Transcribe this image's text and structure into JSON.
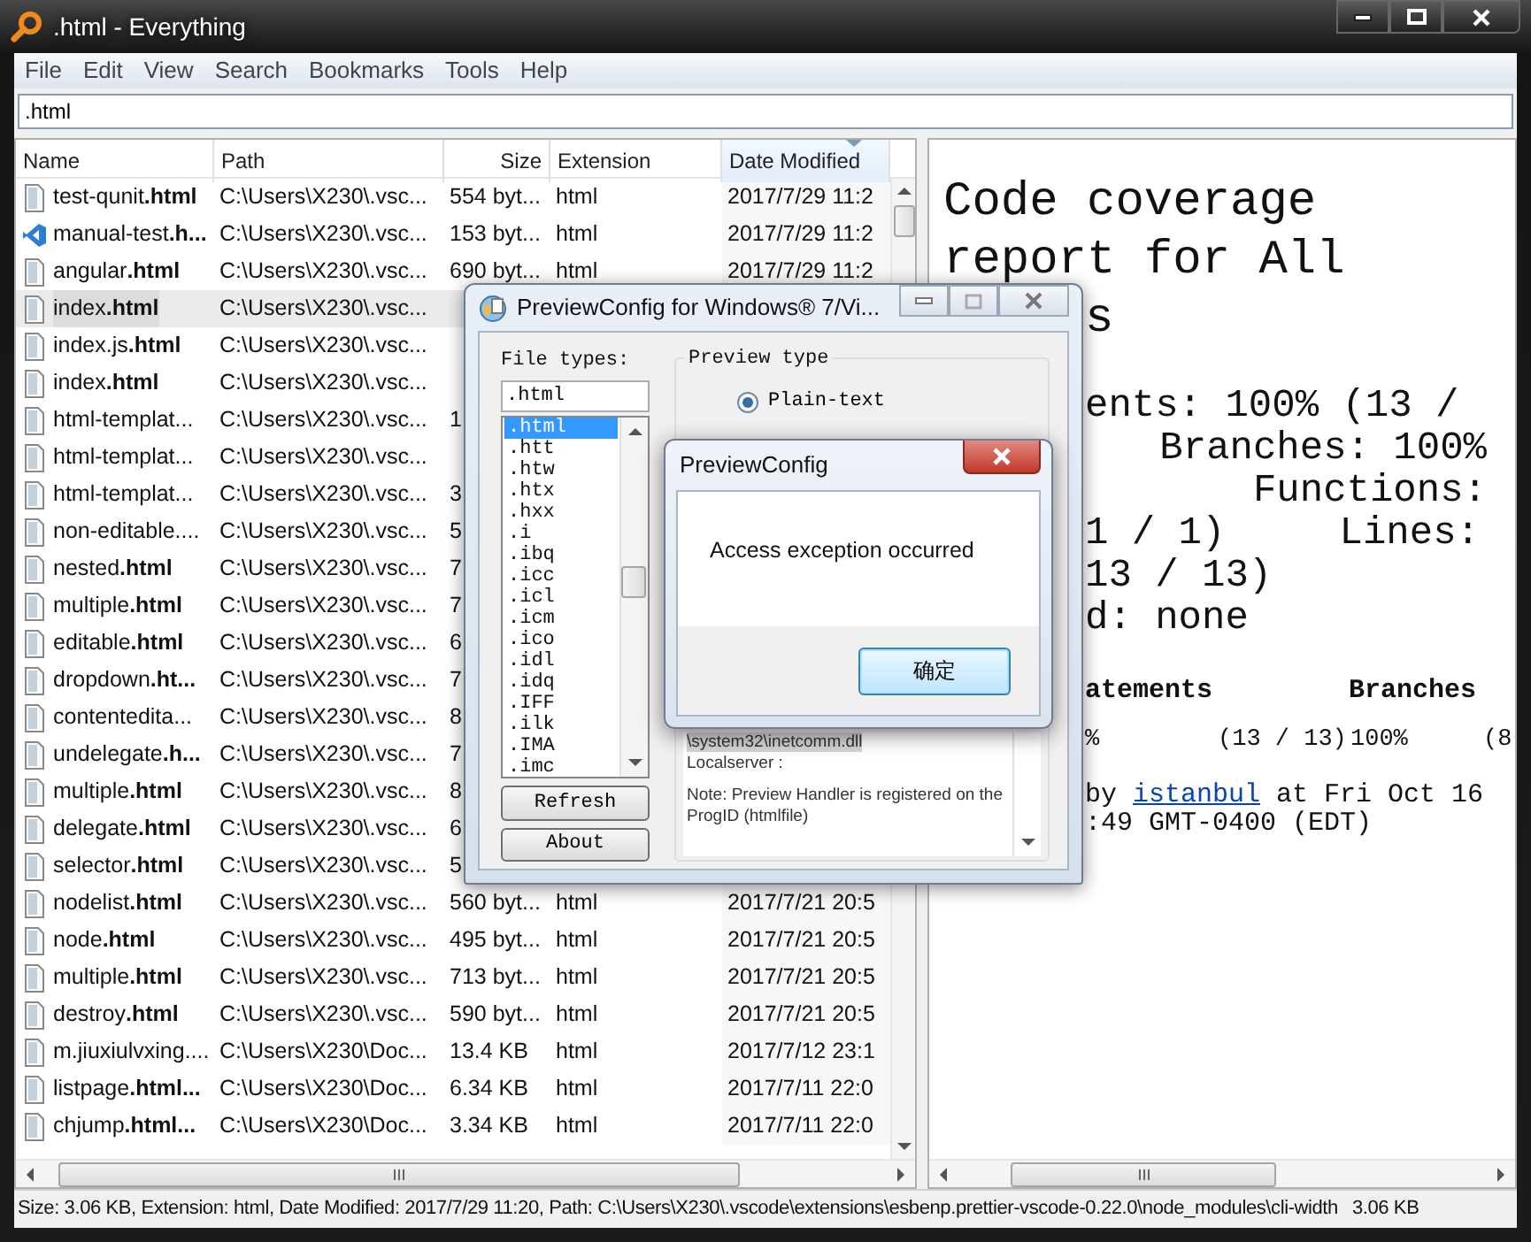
{
  "window": {
    "title": ".html - Everything"
  },
  "menu": [
    "File",
    "Edit",
    "View",
    "Search",
    "Bookmarks",
    "Tools",
    "Help"
  ],
  "search": {
    "value": ".html"
  },
  "file_list": {
    "columns": [
      {
        "label": "Name",
        "sorted": false
      },
      {
        "label": "Path",
        "sorted": false
      },
      {
        "label": "Size",
        "sorted": false
      },
      {
        "label": "Extension",
        "sorted": false
      },
      {
        "label": "Date Modified",
        "sorted": true
      }
    ],
    "rows": [
      {
        "kind": "page",
        "name": "test-qunit**.html**",
        "path": "C:\\Users\\X230\\.vsc...",
        "size": "554 byt...",
        "ext": "html",
        "date": "2017/7/29 11:2",
        "selected": false
      },
      {
        "kind": "vscode",
        "name": "manual-test**.h...**",
        "path": "C:\\Users\\X230\\.vsc...",
        "size": "153 byt...",
        "ext": "html",
        "date": "2017/7/29 11:2",
        "selected": false
      },
      {
        "kind": "page",
        "name": "angular**.html**",
        "path": "C:\\Users\\X230\\.vsc...",
        "size": "690 byt...",
        "ext": "html",
        "date": "2017/7/29 11:2",
        "selected": false
      },
      {
        "kind": "page",
        "name": "index**.html**",
        "path": "C:\\Users\\X230\\.vsc...",
        "selected": true
      },
      {
        "kind": "page",
        "name": "index.js**.html**",
        "path": "C:\\Users\\X230\\.vsc...",
        "selected": false
      },
      {
        "kind": "page",
        "name": "index**.html**",
        "path": "C:\\Users\\X230\\.vsc...",
        "selected": false
      },
      {
        "kind": "page",
        "name": "html-templat...",
        "path": "C:\\Users\\X230\\.vsc...",
        "size": "1",
        "selected": false
      },
      {
        "kind": "page",
        "name": "html-templat...",
        "path": "C:\\Users\\X230\\.vsc...",
        "selected": false
      },
      {
        "kind": "page",
        "name": "html-templat...",
        "path": "C:\\Users\\X230\\.vsc...",
        "size": "3",
        "selected": false
      },
      {
        "kind": "page",
        "name": "non-editable....",
        "path": "C:\\Users\\X230\\.vsc...",
        "size": "5",
        "selected": false
      },
      {
        "kind": "page",
        "name": "nested**.html**",
        "path": "C:\\Users\\X230\\.vsc...",
        "size": "7",
        "selected": false
      },
      {
        "kind": "page",
        "name": "multiple**.html**",
        "path": "C:\\Users\\X230\\.vsc...",
        "size": "7",
        "selected": false
      },
      {
        "kind": "page",
        "name": "editable**.html**",
        "path": "C:\\Users\\X230\\.vsc...",
        "size": "6",
        "selected": false
      },
      {
        "kind": "page",
        "name": "dropdown**.ht...**",
        "path": "C:\\Users\\X230\\.vsc...",
        "size": "7",
        "selected": false
      },
      {
        "kind": "page",
        "name": "contentedita...",
        "path": "C:\\Users\\X230\\.vsc...",
        "size": "8",
        "selected": false
      },
      {
        "kind": "page",
        "name": "undelegate**.h...**",
        "path": "C:\\Users\\X230\\.vsc...",
        "size": "7",
        "selected": false
      },
      {
        "kind": "page",
        "name": "multiple**.html**",
        "path": "C:\\Users\\X230\\.vsc...",
        "size": "8",
        "selected": false
      },
      {
        "kind": "page",
        "name": "delegate**.html**",
        "path": "C:\\Users\\X230\\.vsc...",
        "size": "6",
        "selected": false
      },
      {
        "kind": "page",
        "name": "selector**.html**",
        "path": "C:\\Users\\X230\\.vsc...",
        "size": "5",
        "selected": false
      },
      {
        "kind": "page",
        "name": "nodelist**.html**",
        "path": "C:\\Users\\X230\\.vsc...",
        "size": "560 byt...",
        "ext": "html",
        "date": "2017/7/21 20:5",
        "selected": false
      },
      {
        "kind": "page",
        "name": "node**.html**",
        "path": "C:\\Users\\X230\\.vsc...",
        "size": "495 byt...",
        "ext": "html",
        "date": "2017/7/21 20:5",
        "selected": false
      },
      {
        "kind": "page",
        "name": "multiple**.html**",
        "path": "C:\\Users\\X230\\.vsc...",
        "size": "713 byt...",
        "ext": "html",
        "date": "2017/7/21 20:5",
        "selected": false
      },
      {
        "kind": "page",
        "name": "destroy**.html**",
        "path": "C:\\Users\\X230\\.vsc...",
        "size": "590 byt...",
        "ext": "html",
        "date": "2017/7/21 20:5",
        "selected": false
      },
      {
        "kind": "page",
        "name": "m.jiuxiulvxing....",
        "path": "C:\\Users\\X230\\Doc...",
        "size": "13.4 KB",
        "ext": "html",
        "date": "2017/7/12 23:1",
        "selected": false
      },
      {
        "kind": "page",
        "name": "listpage**.html...**",
        "path": "C:\\Users\\X230\\Doc...",
        "size": "6.34 KB",
        "ext": "html",
        "date": "2017/7/11 22:0",
        "selected": false
      },
      {
        "kind": "page",
        "name": "chjump**.html...**",
        "path": "C:\\Users\\X230\\Doc...",
        "size": "3.34 KB",
        "ext": "html",
        "date": "2017/7/11 22:0",
        "selected": false
      }
    ]
  },
  "preview": {
    "lines": [
      {
        "kind": "title",
        "segments": [
          "Code coverage"
        ]
      },
      {
        "kind": "title",
        "segments": [
          "report for All"
        ]
      },
      {
        "kind": "title-cut",
        "segments": [
          "s"
        ]
      },
      {
        "kind": "summary-cut",
        "segments": [
          "ents: 100% (13 /"
        ]
      },
      {
        "kind": "summary-right",
        "segments": [
          "Branches: 100%"
        ]
      },
      {
        "kind": "summary-right",
        "segments": [
          "Functions:"
        ]
      },
      {
        "kind": "summary-spread",
        "segments": [
          "1 / 1)",
          "Lines:"
        ]
      },
      {
        "kind": "summary-cut",
        "segments": [
          "13 / 13)"
        ]
      },
      {
        "kind": "summary-cut",
        "segments": [
          "d: none"
        ]
      },
      {
        "kind": "table-head",
        "segments": [
          "atements",
          "Branches"
        ]
      },
      {
        "kind": "table-row",
        "segments": [
          "%",
          "(13 / 13)",
          "100%",
          "(8"
        ]
      }
    ],
    "footer": {
      "before": "by",
      "link": "istanbul",
      "after": "at Fri Oct 16"
    },
    "footer_time": ":49 GMT-0400 (EDT)"
  },
  "status_bar": {
    "text": "Size: 3.06 KB, Extension: html, Date Modified: 2017/7/29 11:20, Path: C:\\Users\\X230\\.vscode\\extensions\\esbenp.prettier-vscode-0.22.0\\node_modules\\cli-width",
    "size": "3.06 KB"
  },
  "config_dialog": {
    "title": "PreviewConfig for Windows® 7/Vi...",
    "file_types_label": "File types:",
    "file_types_value": ".html",
    "file_types": [
      {
        "label": ".html",
        "selected": true
      },
      {
        "label": ".htt",
        "selected": false
      },
      {
        "label": ".htw",
        "selected": false
      },
      {
        "label": ".htx",
        "selected": false
      },
      {
        "label": ".hxx",
        "selected": false
      },
      {
        "label": ".i",
        "selected": false
      },
      {
        "label": ".ibq",
        "selected": false
      },
      {
        "label": ".icc",
        "selected": false
      },
      {
        "label": ".icl",
        "selected": false
      },
      {
        "label": ".icm",
        "selected": false
      },
      {
        "label": ".ico",
        "selected": false
      },
      {
        "label": ".idl",
        "selected": false
      },
      {
        "label": ".idq",
        "selected": false
      },
      {
        "label": ".IFF",
        "selected": false
      },
      {
        "label": ".ilk",
        "selected": false
      },
      {
        "label": ".IMA",
        "selected": false
      },
      {
        "label": ".imc",
        "selected": false
      }
    ],
    "buttons": [
      "Refresh",
      "About"
    ],
    "preview_type_label": "Preview type",
    "options": [
      {
        "label": "Plain-text",
        "checked": true
      }
    ],
    "details": [
      {
        "kind": "line",
        "text": "\\system32\\inetcomm.dll",
        "highlighted": true
      },
      {
        "kind": "line",
        "text": "Localserver :",
        "highlighted": false
      },
      {
        "kind": "note",
        "text": "Note: Preview Handler is registered on the ProgID (htmlfile)",
        "highlighted": false
      }
    ]
  },
  "message_box": {
    "title": "PreviewConfig",
    "message": "Access exception occurred",
    "button": "确定"
  }
}
